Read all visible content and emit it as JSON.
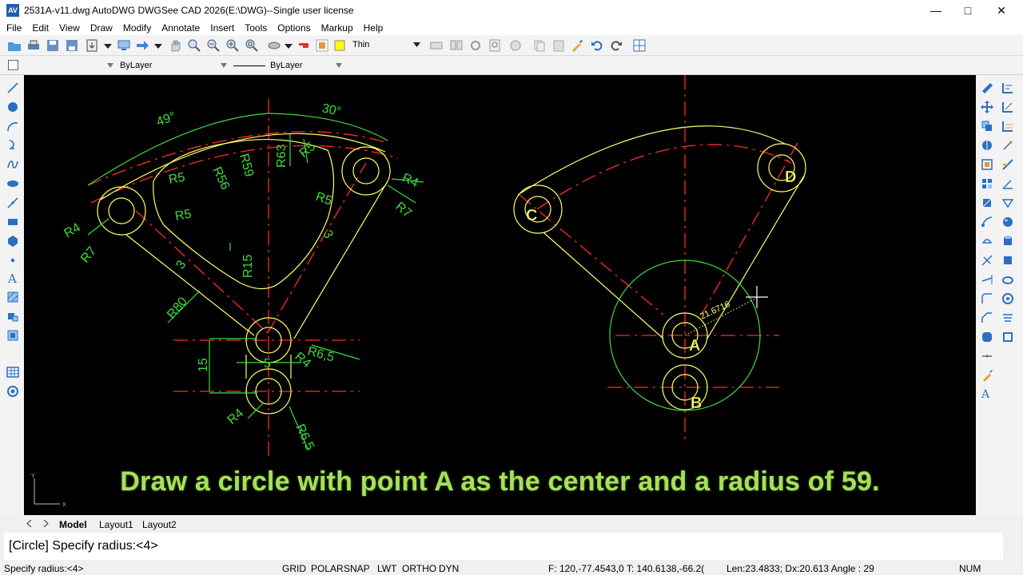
{
  "window": {
    "title": "2531A-v11.dwg AutoDWG DWGSee CAD 2026(E:\\DWG)--Single user license",
    "app_icon_text": "AV"
  },
  "menu": [
    "File",
    "Edit",
    "View",
    "Draw",
    "Modify",
    "Annotate",
    "Insert",
    "Tools",
    "Options",
    "Markup",
    "Help"
  ],
  "toolbar": {
    "lineweight_value": "Thin",
    "layer_color_value": "ByLayer",
    "linetype_value": "ByLayer"
  },
  "drawing_left": {
    "dims": {
      "angle_left": "49°",
      "angle_right": "30°",
      "r63": "R63",
      "r59": "R59",
      "r56": "R56",
      "r5_top_left": "R5",
      "r5_top": "R5",
      "r5_mid_left": "R5",
      "r5_right": "R5",
      "r4_left": "R4",
      "r7_left": "R7",
      "r4_right": "R4",
      "r7_right": "R7",
      "three_left": "3",
      "three_right": "3",
      "r15": "R15",
      "r80": "R80",
      "r6_5_upper": "R6,5",
      "r4_upper": "R4",
      "r4_lower": "R4",
      "r6_5_lower": "R6,5",
      "fifteen": "15",
      "five": "5"
    }
  },
  "drawing_right": {
    "points": {
      "a": "A",
      "b": "B",
      "c": "C",
      "d": "D"
    },
    "dynamic_input": "21.6716"
  },
  "caption": "Draw a circle with point A as the center and a radius of 59.",
  "layout_tabs": [
    "Model",
    "Layout1",
    "Layout2"
  ],
  "command_line": "[Circle] Specify radius:<4>",
  "status": {
    "prompt": "Specify radius:<4>",
    "toggles": [
      "GRID",
      "POLAR",
      "SNAP",
      "LWT",
      "ORTHO",
      "DYN"
    ],
    "coords": "F: 120,-77.4543,0 T:  140.6138,-66.2(",
    "measure": "Len:23.4833; Dx:20.613 Angle : 29",
    "num": "NUM"
  }
}
